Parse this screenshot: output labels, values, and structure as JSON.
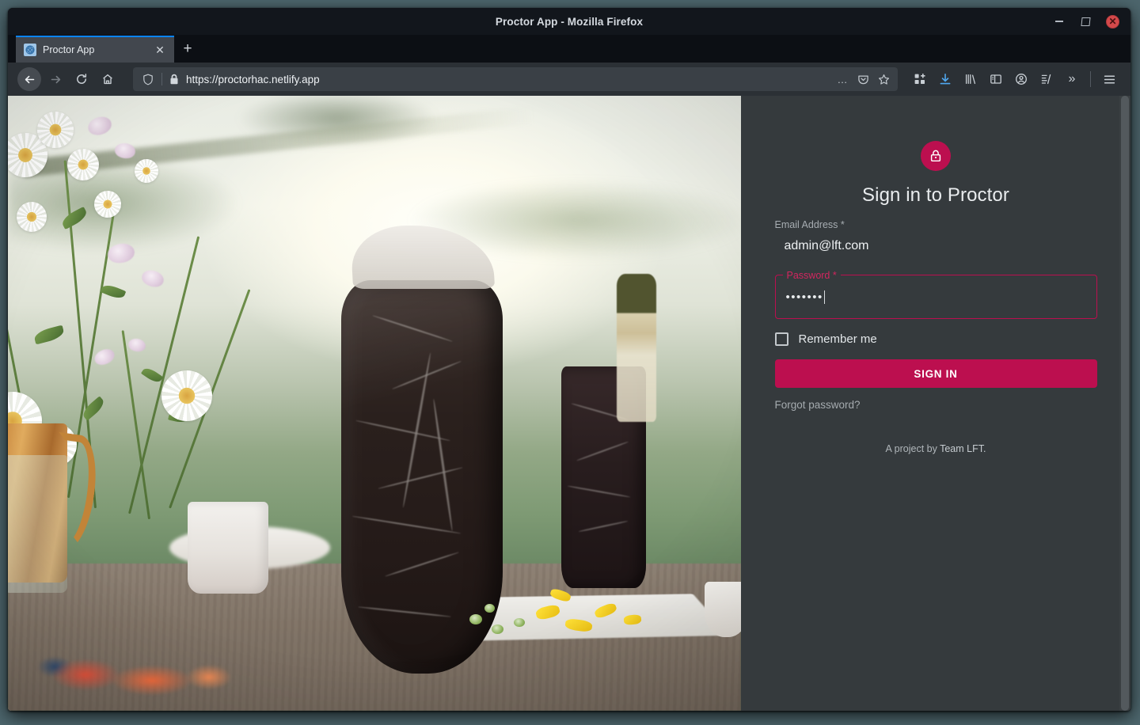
{
  "window": {
    "title": "Proctor App - Mozilla Firefox",
    "controls": {
      "minimize_label": "–",
      "maximize_label": "❐",
      "close_label": "✕"
    }
  },
  "tabs": [
    {
      "title": "Proctor App",
      "favicon": "proctor-favicon",
      "close_label": "✕",
      "active": true
    }
  ],
  "tabstrip": {
    "new_tab_label": "+"
  },
  "toolbar": {
    "back_icon": "back-arrow-icon",
    "forward_icon": "forward-arrow-icon",
    "reload_icon": "reload-icon",
    "home_icon": "home-icon",
    "extensions_icon": "extensions-grid-icon",
    "downloads_icon": "download-arrow-icon",
    "library_icon": "library-books-icon",
    "sidebar_icon": "sidebar-panel-icon",
    "account_icon": "account-avatar-icon",
    "sync_icon": "reader-list-icon",
    "overflow_label": "»",
    "menu_icon": "hamburger-menu-icon"
  },
  "urlbar": {
    "url": "https://proctorhac.netlify.app",
    "shield_icon": "tracking-protection-shield-icon",
    "lock_icon": "padlock-secure-icon",
    "page_actions_label": "…",
    "pocket_icon": "pocket-icon",
    "bookmark_icon": "star-bookmark-icon"
  },
  "login": {
    "lock_icon": "lock-icon",
    "title": "Sign in to Proctor",
    "email": {
      "label": "Email Address",
      "required_marker": "*",
      "value": "admin@lft.com",
      "placeholder": "Email Address"
    },
    "password": {
      "label": "Password",
      "required_marker": "*",
      "value": "•••••••",
      "placeholder": "Password",
      "focused": true
    },
    "remember_me_label": "Remember me",
    "remember_me_checked": false,
    "submit_label": "SIGN IN",
    "forgot_password_label": "Forgot password?",
    "credit_prefix": "A project by ",
    "credit_team": "Team LFT."
  },
  "theme": {
    "accent": "#bc0f4f",
    "accent_label": "#d2265f",
    "panel_bg": "#353a3d",
    "text_primary": "#e9ecee",
    "text_secondary": "#a7adb2",
    "tab_accent": "#0a84ff",
    "desktop_bg": "#4d666d"
  },
  "hero": {
    "alt": "Outdoor table at sunset with wildflowers in a copper vase, a dark marble carafe, marble tumbler, wine bottle and sliced yellow peppers on a white board"
  }
}
